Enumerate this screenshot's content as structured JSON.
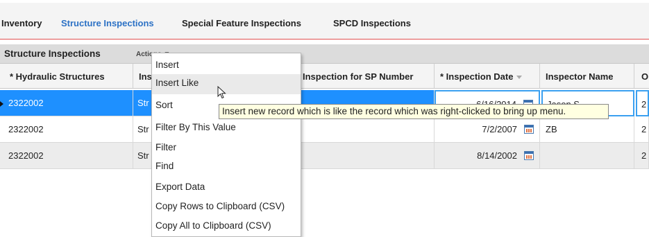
{
  "tabs": [
    {
      "label": "Inventory",
      "active": false
    },
    {
      "label": "Structure Inspections",
      "active": true
    },
    {
      "label": "Special Feature Inspections",
      "active": false
    },
    {
      "label": "SPCD Inspections",
      "active": false
    }
  ],
  "panel": {
    "title": "Structure Inspections",
    "actions_label": "Actions ▼"
  },
  "columns": {
    "hydraulic": "* Hydraulic Structures",
    "insp_type": "Ins",
    "sp_number": "Inspection for SP Number",
    "date": "* Inspection Date",
    "inspector": "Inspector Name",
    "other": "O"
  },
  "rows": [
    {
      "hydraulic": "2322002",
      "type": "Str",
      "sp": "",
      "date": "6/16/2014",
      "inspector": "Jason S",
      "other": "2"
    },
    {
      "hydraulic": "2322002",
      "type": "Str",
      "sp": "",
      "date": "7/2/2007",
      "inspector": "ZB",
      "other": "2"
    },
    {
      "hydraulic": "2322002",
      "type": "Str",
      "sp": "",
      "date": "8/14/2002",
      "inspector": "",
      "other": "2"
    }
  ],
  "context_menu": [
    "Insert",
    "Insert Like",
    "Sort",
    "Filter By This Value",
    "Filter",
    "Find",
    "Export Data",
    "Copy Rows to Clipboard (CSV)",
    "Copy All to Clipboard (CSV)"
  ],
  "tooltip": "Insert new record which is like the record which was right-clicked to bring up menu.",
  "colors": {
    "accent": "#2d72c5",
    "selected_row": "#1e90ff",
    "tooltip_bg": "#ffffe1"
  }
}
